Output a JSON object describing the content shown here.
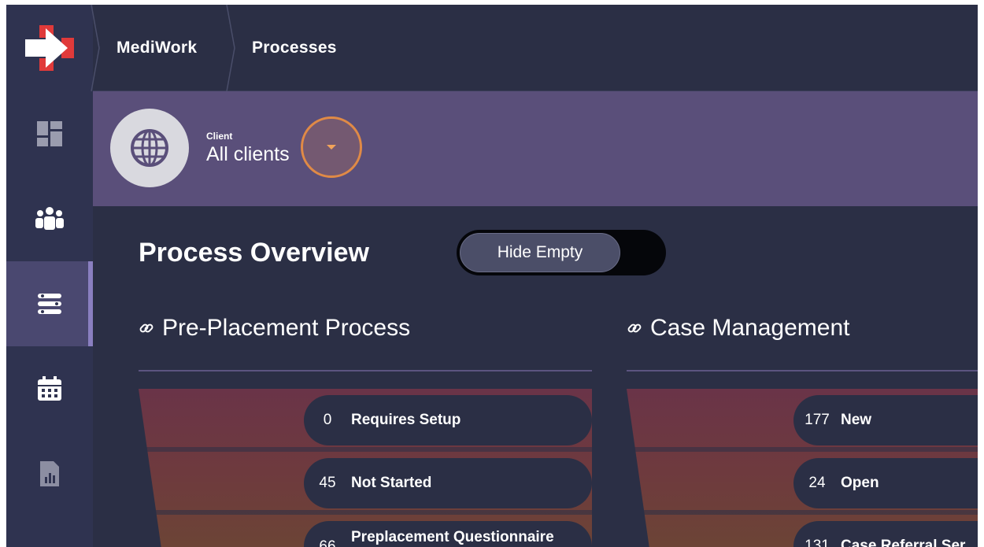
{
  "breadcrumb": [
    "MediWork",
    "Processes"
  ],
  "sidebar": {
    "items": [
      {
        "icon": "dashboard-icon"
      },
      {
        "icon": "users-icon"
      },
      {
        "icon": "processes-icon",
        "active": true
      },
      {
        "icon": "calendar-icon"
      },
      {
        "icon": "report-icon"
      }
    ]
  },
  "client": {
    "label": "Client",
    "value": "All clients",
    "avatar_icon": "globe-icon",
    "dropdown_icon": "caret-down-icon"
  },
  "overview": {
    "title": "Process Overview",
    "toggle_label": "Hide Empty"
  },
  "sections": [
    {
      "title": "Pre-Placement Process",
      "icon": "link-icon",
      "stages": [
        {
          "count": "0",
          "label": "Requires Setup"
        },
        {
          "count": "45",
          "label": "Not Started"
        },
        {
          "count": "66",
          "label": "Preplacement Questionnaire"
        }
      ]
    },
    {
      "title": "Case Management",
      "icon": "link-icon",
      "stages": [
        {
          "count": "177",
          "label": "New"
        },
        {
          "count": "24",
          "label": "Open"
        },
        {
          "count": "131",
          "label": "Case Referral Ser"
        }
      ]
    }
  ],
  "colors": {
    "background": "#2b2f45",
    "sidebar": "#2f3350",
    "client_band": "#5a4f7a",
    "accent_orange": "#e08a46",
    "brand_red": "#e03a3a"
  }
}
